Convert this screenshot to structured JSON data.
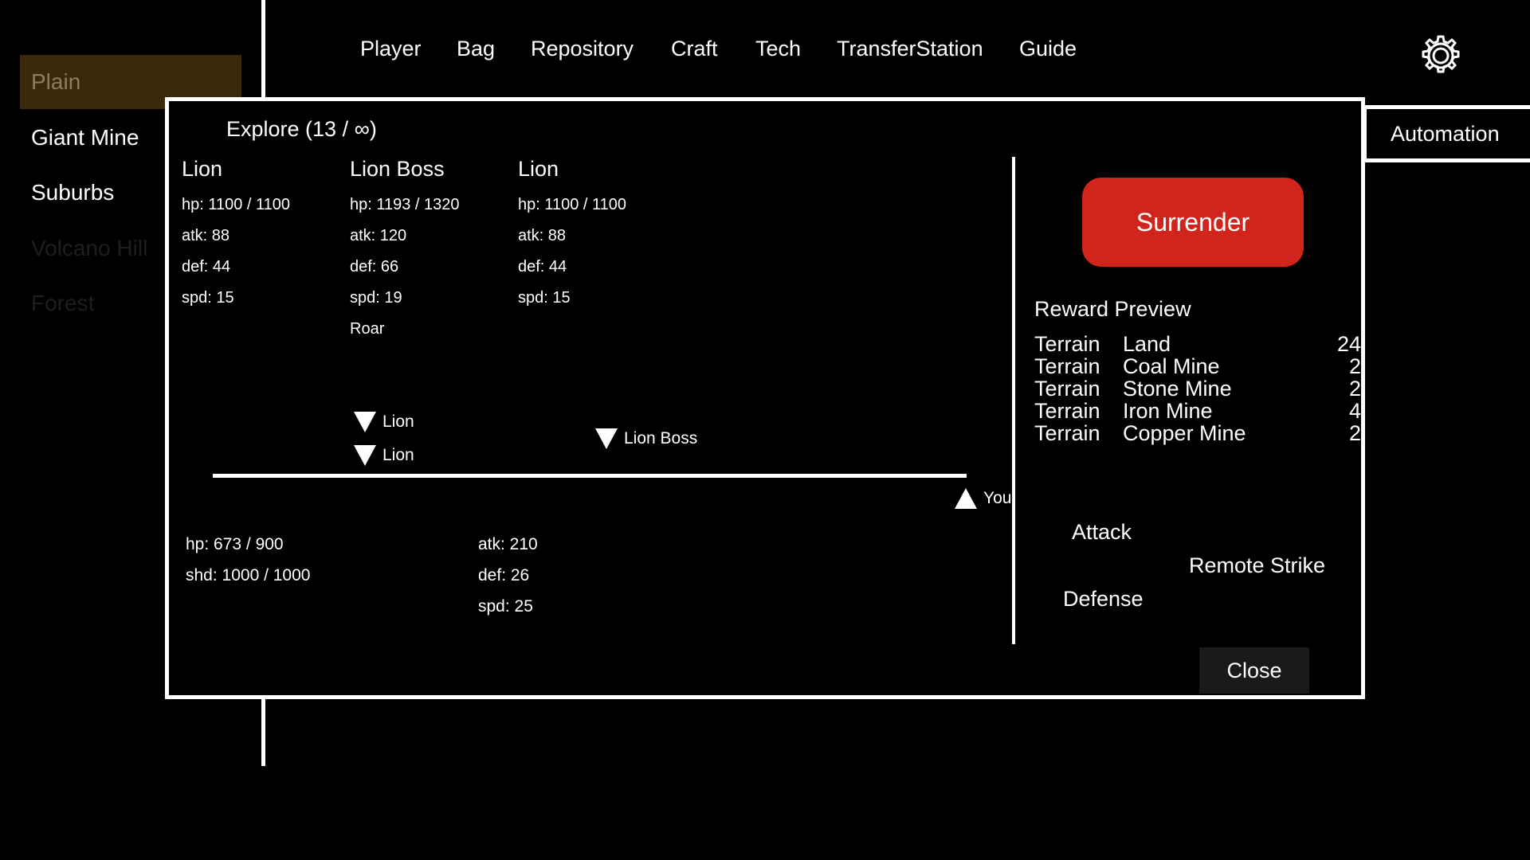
{
  "sidebar": {
    "items": [
      {
        "label": "Plain",
        "active": true
      },
      {
        "label": "Giant Mine"
      },
      {
        "label": "Suburbs"
      },
      {
        "label": "Volcano Hill"
      },
      {
        "label": "Forest"
      }
    ]
  },
  "nav": {
    "items": [
      "Player",
      "Bag",
      "Repository",
      "Craft",
      "Tech",
      "TransferStation",
      "Guide"
    ]
  },
  "automation_label": "Automation",
  "modal": {
    "title": "Explore (13 / ∞)",
    "enemies": [
      {
        "name": "Lion",
        "hp": "hp: 1100 / 1100",
        "atk": "atk: 88",
        "def": "def: 44",
        "spd": "spd: 15",
        "skill": ""
      },
      {
        "name": "Lion Boss",
        "hp": "hp: 1193 / 1320",
        "atk": "atk: 120",
        "def": "def: 66",
        "spd": "spd: 19",
        "skill": "Roar"
      },
      {
        "name": "Lion",
        "hp": "hp: 1100 / 1100",
        "atk": "atk: 88",
        "def": "def: 44",
        "spd": "spd: 15",
        "skill": ""
      }
    ],
    "track_markers": {
      "enemy1": "Lion",
      "enemy2": "Lion",
      "boss": "Lion Boss",
      "player": "You"
    },
    "player": {
      "hp": "hp: 673 / 900",
      "shd": "shd: 1000 / 1000",
      "atk": "atk: 210",
      "def": "def: 26",
      "spd": "spd: 25"
    },
    "surrender_label": "Surrender",
    "reward_title": "Reward Preview",
    "rewards": [
      {
        "type": "Terrain",
        "name": "Land",
        "qty": "24"
      },
      {
        "type": "Terrain",
        "name": "Coal Mine",
        "qty": "2"
      },
      {
        "type": "Terrain",
        "name": "Stone Mine",
        "qty": "2"
      },
      {
        "type": "Terrain",
        "name": "Iron Mine",
        "qty": "4"
      },
      {
        "type": "Terrain",
        "name": "Copper Mine",
        "qty": "2"
      }
    ],
    "actions": {
      "attack": "Attack",
      "remote": "Remote Strike",
      "defense": "Defense"
    },
    "close_label": "Close"
  },
  "colors": {
    "surrender": "#d1241c",
    "active_sidebar_bg": "#3a2a09",
    "active_sidebar_text": "#8e7d61"
  }
}
